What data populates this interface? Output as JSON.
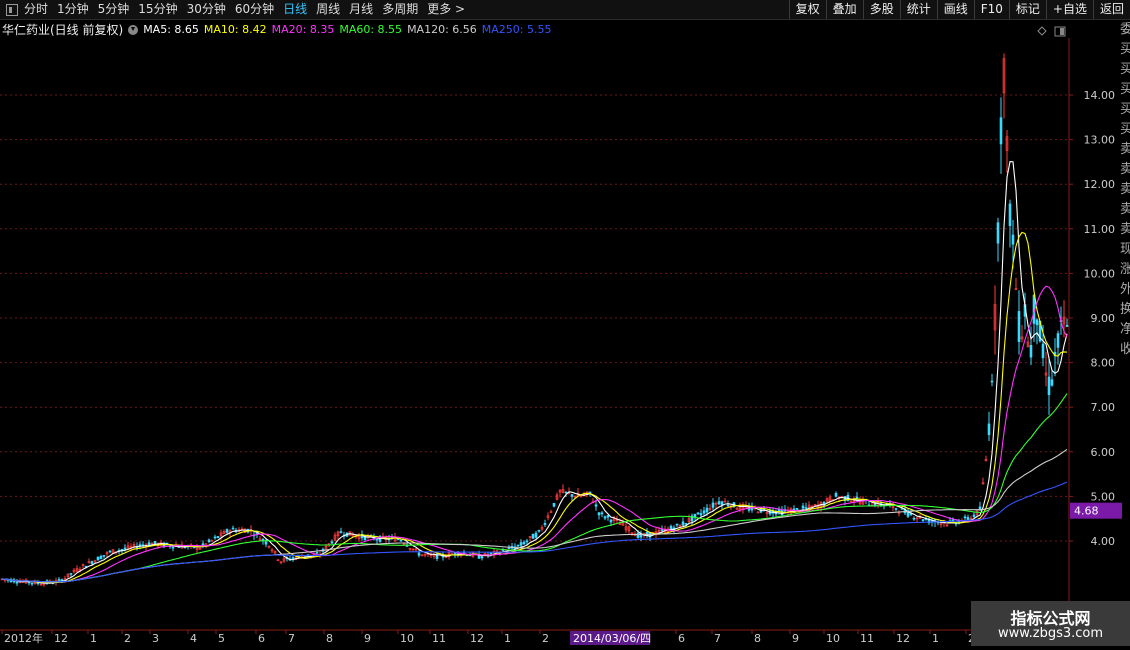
{
  "toolbar": {
    "periods": [
      "分时",
      "1分钟",
      "5分钟",
      "15分钟",
      "30分钟",
      "60分钟",
      "日线",
      "周线",
      "月线",
      "多周期",
      "更多 >"
    ],
    "active_period": "日线",
    "actions": [
      "复权",
      "叠加",
      "多股",
      "统计",
      "画线",
      "F10",
      "标记",
      "+自选",
      "返回"
    ]
  },
  "indicator_bar": {
    "stock": "华仁药业(日线 前复权)",
    "ma": [
      {
        "label": "MA5: 8.65",
        "color": "#ffffff"
      },
      {
        "label": "MA10: 8.42",
        "color": "#ffff00"
      },
      {
        "label": "MA20: 8.35",
        "color": "#ff33ff"
      },
      {
        "label": "MA60: 8.55",
        "color": "#33ff33"
      },
      {
        "label": "MA120: 6.56",
        "color": "#cccccc"
      },
      {
        "label": "MA250: 5.55",
        "color": "#3355ff"
      }
    ]
  },
  "chart_data": {
    "type": "candlestick",
    "y_ticks": [
      "14.00",
      "13.00",
      "12.00",
      "11.00",
      "10.00",
      "9.00",
      "8.00",
      "7.00",
      "6.00",
      "5.00",
      "4.00"
    ],
    "ylim": [
      3.6,
      15.2
    ],
    "current_price_label": "4.68",
    "x_ticks": [
      "2012年",
      "12",
      "1",
      "2",
      "3",
      "4",
      "5",
      "6",
      "7",
      "8",
      "9",
      "10",
      "11",
      "12",
      "1",
      "2",
      "6",
      "7",
      "8",
      "9",
      "10",
      "11",
      "12",
      "1",
      "2"
    ],
    "crosshair_date": "2014/03/06/四",
    "price_profile": [
      [
        0,
        3.15
      ],
      [
        40,
        3.05
      ],
      [
        60,
        3.1
      ],
      [
        80,
        3.4
      ],
      [
        110,
        3.75
      ],
      [
        150,
        3.95
      ],
      [
        170,
        3.9
      ],
      [
        200,
        3.85
      ],
      [
        230,
        4.25
      ],
      [
        250,
        4.25
      ],
      [
        270,
        3.9
      ],
      [
        280,
        3.55
      ],
      [
        300,
        3.65
      ],
      [
        320,
        3.7
      ],
      [
        340,
        4.2
      ],
      [
        360,
        4.1
      ],
      [
        380,
        4.05
      ],
      [
        400,
        4.05
      ],
      [
        420,
        3.7
      ],
      [
        440,
        3.65
      ],
      [
        460,
        3.75
      ],
      [
        480,
        3.65
      ],
      [
        500,
        3.75
      ],
      [
        520,
        3.9
      ],
      [
        540,
        4.2
      ],
      [
        560,
        5.1
      ],
      [
        580,
        5.0
      ],
      [
        590,
        5.05
      ],
      [
        600,
        4.6
      ],
      [
        620,
        4.4
      ],
      [
        640,
        4.1
      ],
      [
        660,
        4.2
      ],
      [
        680,
        4.35
      ],
      [
        700,
        4.6
      ],
      [
        720,
        4.9
      ],
      [
        740,
        4.75
      ],
      [
        760,
        4.7
      ],
      [
        780,
        4.65
      ],
      [
        800,
        4.7
      ],
      [
        820,
        4.8
      ],
      [
        835,
        5.0
      ],
      [
        850,
        4.95
      ],
      [
        870,
        4.85
      ],
      [
        890,
        4.8
      ],
      [
        910,
        4.6
      ],
      [
        930,
        4.45
      ],
      [
        950,
        4.4
      ],
      [
        970,
        4.5
      ],
      [
        980,
        4.7
      ],
      [
        988,
        6.2
      ],
      [
        995,
        9.0
      ],
      [
        1000,
        12.5
      ],
      [
        1003,
        15.2
      ],
      [
        1008,
        12.0
      ],
      [
        1015,
        10.0
      ],
      [
        1020,
        8.5
      ],
      [
        1025,
        9.2
      ],
      [
        1030,
        8.0
      ],
      [
        1035,
        9.5
      ],
      [
        1040,
        8.6
      ],
      [
        1045,
        7.8
      ],
      [
        1050,
        7.4
      ],
      [
        1055,
        8.1
      ],
      [
        1060,
        8.6
      ],
      [
        1065,
        8.9
      ],
      [
        1069,
        8.4
      ]
    ],
    "ma_series": [
      {
        "name": "MA5",
        "color": "#ffffff",
        "lag": 4
      },
      {
        "name": "MA10",
        "color": "#ffff00",
        "lag": 9
      },
      {
        "name": "MA20",
        "color": "#ff33ff",
        "lag": 18
      },
      {
        "name": "MA60",
        "color": "#33ff33",
        "lag": 45
      },
      {
        "name": "MA120",
        "color": "#cccccc",
        "lag": 90
      },
      {
        "name": "MA250",
        "color": "#3355ff",
        "lag": 180
      }
    ]
  },
  "watermark": {
    "line1": "指标公式网",
    "line2": "www.zbgs3.com"
  }
}
